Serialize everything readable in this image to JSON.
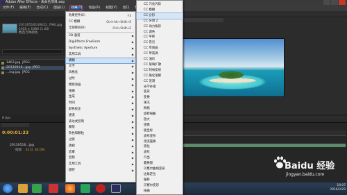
{
  "window": {
    "title": "Adobe After Effects - 未命名项目.aep"
  },
  "menubar": [
    "文件(F)",
    "编辑(E)",
    "合成(C)",
    "图层(L)",
    "效果(T)",
    "动画(A)",
    "视图(V)",
    "窗口",
    "帮助(H)"
  ],
  "project": {
    "info_lines": [
      "20130516140622_798t.jpg",
      "1920 x 1080 (1.00)",
      "数百万种颜色"
    ],
    "rows": [
      {
        "name": "1463.jpg",
        "type": "JPEG"
      },
      {
        "name": "20130516...jpg",
        "type": "JPEG"
      },
      {
        "name": "...ing.jpg",
        "type": "JPEG"
      }
    ],
    "footer": "8 bpc"
  },
  "timeline": {
    "timecode": "0:00:01:23",
    "layer_name": "20130516...jpg",
    "layer_prop": "缩放",
    "layer_value": "31.0, 32.0%"
  },
  "menu1": {
    "items": [
      {
        "label": "效果控件(E)",
        "shortcut": "F3",
        "arrow": false
      },
      {
        "label": "CC 模糊",
        "shortcut": "Ctrl+Alt+Shift+E",
        "arrow": false
      },
      {
        "label": "全部移除(R)",
        "shortcut": "Ctrl+Shift+E",
        "arrow": false
      },
      {
        "sep": true
      },
      {
        "label": "3D 通道",
        "arrow": true
      },
      {
        "label": "DigiEffects FreeForm",
        "arrow": true
      },
      {
        "label": "Synthetic Aperture",
        "arrow": true
      },
      {
        "label": "实用工具",
        "arrow": true
      },
      {
        "label": "模糊",
        "arrow": true,
        "highlight": true
      },
      {
        "label": "文字",
        "arrow": true
      },
      {
        "label": "风格化",
        "arrow": true
      },
      {
        "label": "过时",
        "arrow": true
      },
      {
        "label": "模拟动画",
        "arrow": true
      },
      {
        "label": "扭曲",
        "arrow": true
      },
      {
        "label": "生成",
        "arrow": true
      },
      {
        "label": "时间",
        "arrow": true
      },
      {
        "label": "颜色校正",
        "arrow": true
      },
      {
        "label": "通道",
        "arrow": true
      },
      {
        "label": "表达式控制",
        "arrow": true
      },
      {
        "label": "蒙版",
        "arrow": true
      },
      {
        "label": "杂色和颗粒",
        "arrow": true
      },
      {
        "label": "过渡",
        "arrow": true
      },
      {
        "label": "透视",
        "arrow": true
      },
      {
        "label": "遮罩",
        "arrow": true
      },
      {
        "label": "音频",
        "arrow": true
      },
      {
        "label": "实用工具",
        "arrow": true
      },
      {
        "label": "键控",
        "arrow": true
      }
    ]
  },
  "menu2": {
    "items": [
      {
        "label": "CC 汽化闪烁"
      },
      {
        "label": "CC 模糊"
      },
      {
        "label": "CC 分形",
        "highlight": true
      },
      {
        "label": "CC 分割 2"
      },
      {
        "label": "CC 动力角形"
      },
      {
        "label": "CC 调色"
      },
      {
        "label": "CC 平移"
      },
      {
        "label": "CC 卷页"
      },
      {
        "label": "CC 草南画"
      },
      {
        "label": "CC 草南调"
      },
      {
        "label": "CC 油彩"
      },
      {
        "label": "CC 玻璃扩散"
      },
      {
        "label": "CC 阿林反射"
      },
      {
        "label": "CC 融化溶解"
      },
      {
        "label": "CC 涟漪"
      },
      {
        "label": "光学补偿"
      },
      {
        "label": "变形"
      },
      {
        "label": "变换"
      },
      {
        "label": "果冻"
      },
      {
        "label": "网格"
      },
      {
        "label": "旋转扭曲"
      },
      {
        "label": "放大"
      },
      {
        "label": "镜像"
      },
      {
        "label": "极坐标"
      },
      {
        "label": "波形变形"
      },
      {
        "label": "湍流置换"
      },
      {
        "label": "液化"
      },
      {
        "label": "波纹"
      },
      {
        "label": "凸出"
      },
      {
        "label": "置换图"
      },
      {
        "label": "贝塞尔曲线变形"
      },
      {
        "label": "边角定位"
      },
      {
        "label": "偏移"
      },
      {
        "label": "贝塞尔变形"
      },
      {
        "label": "扭曲"
      }
    ]
  },
  "taskbar": {
    "time": "18:07",
    "date": "2016/3/29"
  },
  "watermark": {
    "brand": "Baidu 经验",
    "url": "jingyan.baidu.com"
  }
}
